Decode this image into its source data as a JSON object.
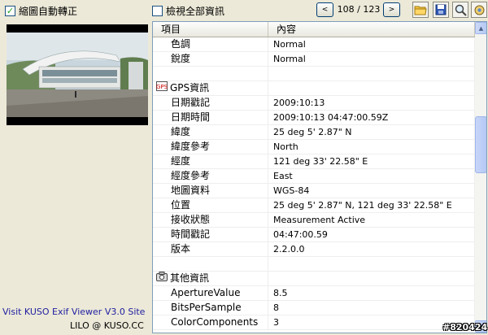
{
  "toolbar": {
    "rotate_checkbox_label": "縮圖自動轉正",
    "rotate_checked": true,
    "show_all_label": "檢視全部資訊",
    "show_all_checked": false,
    "prev_symbol": "<",
    "next_symbol": ">",
    "counter": "108 / 123",
    "icons": [
      "folder-icon",
      "save-icon",
      "zoom-icon",
      "settings-icon"
    ]
  },
  "table": {
    "headers": [
      "項目",
      "內容"
    ],
    "rows": [
      {
        "item": "色調",
        "value": "Normal"
      },
      {
        "item": "銳度",
        "value": "Normal"
      },
      {
        "item": "",
        "value": ""
      },
      {
        "item": "GPS資訊",
        "value": "",
        "section": true,
        "icon": "gps-icon"
      },
      {
        "item": "日期戳記",
        "value": "2009:10:13"
      },
      {
        "item": "日期時間",
        "value": "2009:10:13 04:47:00.59Z"
      },
      {
        "item": "緯度",
        "value": "25 deg 5' 2.87\" N"
      },
      {
        "item": "緯度參考",
        "value": "North"
      },
      {
        "item": "經度",
        "value": "121 deg 33' 22.58\" E"
      },
      {
        "item": "經度參考",
        "value": "East"
      },
      {
        "item": "地圖資料",
        "value": "WGS-84"
      },
      {
        "item": "位置",
        "value": "25 deg 5' 2.87\" N, 121 deg 33' 22.58\" E"
      },
      {
        "item": "接收狀態",
        "value": "Measurement Active"
      },
      {
        "item": "時間戳記",
        "value": "04:47:00.59"
      },
      {
        "item": "版本",
        "value": "2.2.0.0"
      },
      {
        "item": "",
        "value": ""
      },
      {
        "item": "其他資訊",
        "value": "",
        "section": true,
        "icon": "camera-icon"
      },
      {
        "item": "ApertureValue",
        "value": "8.5"
      },
      {
        "item": "BitsPerSample",
        "value": "8"
      },
      {
        "item": "ColorComponents",
        "value": "3"
      }
    ]
  },
  "credits": {
    "line1": "Visit KUSO Exif Viewer V3.0 Site",
    "line2": "LILO @ KUSO.CC"
  },
  "watermark": "#820424"
}
